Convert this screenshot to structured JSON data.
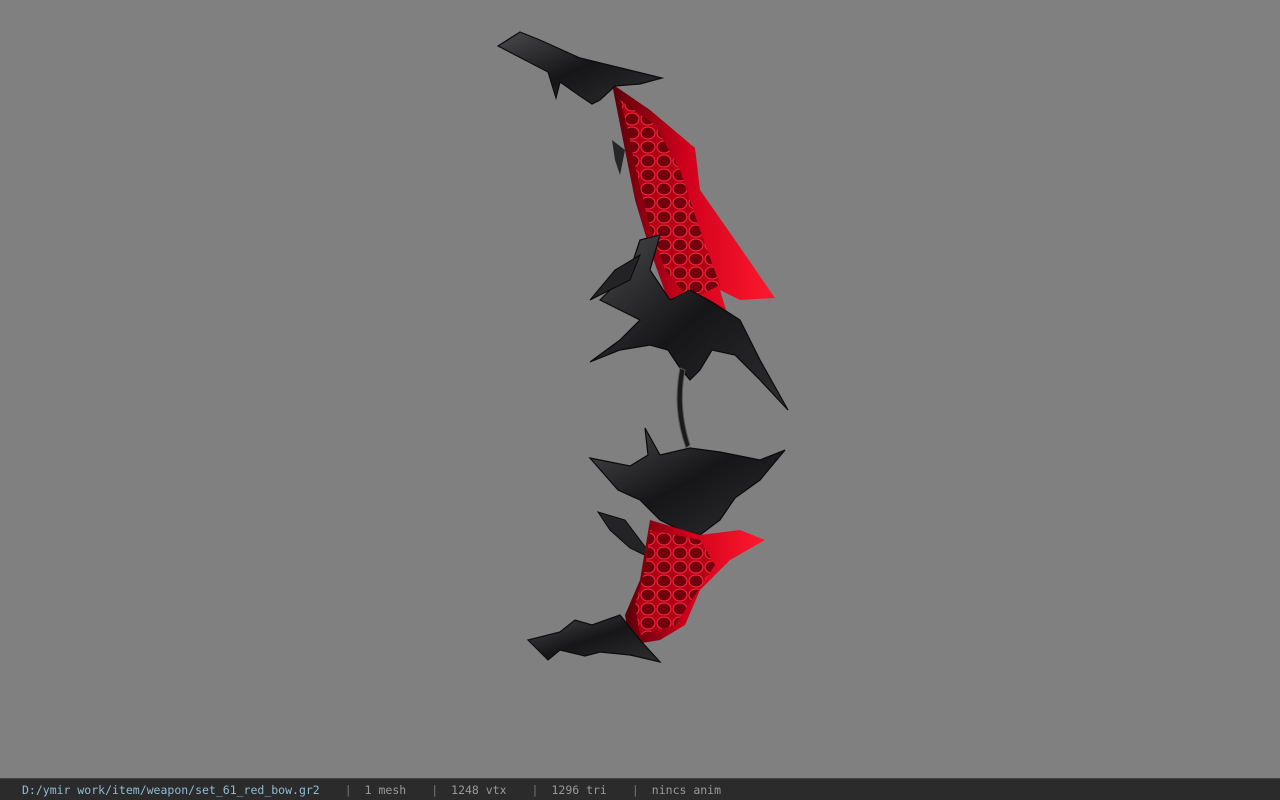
{
  "viewer": {
    "background": "#808080",
    "model_name": "red-bow-model",
    "colors": {
      "accent": "#c8001a",
      "dark": "#1c1c1e",
      "metal": "#3a3a3c"
    }
  },
  "status": {
    "path": "D:/ymir work/item/weapon/set_61_red_bow.gr2",
    "separator": "|",
    "mesh": "1 mesh",
    "vtx": "1248 vtx",
    "tri": "1296 tri",
    "anim": "nincs anim"
  }
}
